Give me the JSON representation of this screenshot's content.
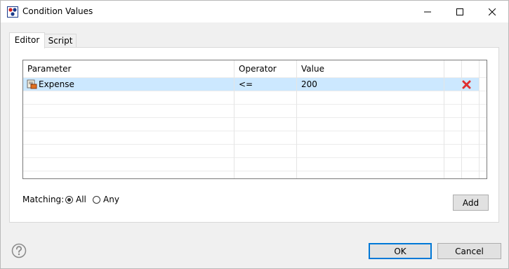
{
  "window": {
    "title": "Condition Values",
    "minimize_icon": "minimize-icon",
    "maximize_icon": "maximize-icon",
    "close_icon": "close-icon"
  },
  "tabs": [
    {
      "label": "Editor",
      "active": true
    },
    {
      "label": "Script",
      "active": false
    }
  ],
  "table": {
    "columns": [
      "Parameter",
      "Operator",
      "Value"
    ],
    "rows": [
      {
        "parameter": "Expense",
        "operator": "<=",
        "value": "200",
        "icon": "parameter-icon",
        "delete_icon": "delete-x-icon"
      }
    ]
  },
  "matching": {
    "label": "Matching:",
    "options": [
      {
        "label": "All",
        "selected": true
      },
      {
        "label": "Any",
        "selected": false
      }
    ]
  },
  "buttons": {
    "add": "Add",
    "ok": "OK",
    "cancel": "Cancel"
  },
  "help_icon": "help-icon",
  "colors": {
    "selection": "#cce8ff",
    "ok_border": "#0078d7",
    "delete": "#e03030"
  }
}
